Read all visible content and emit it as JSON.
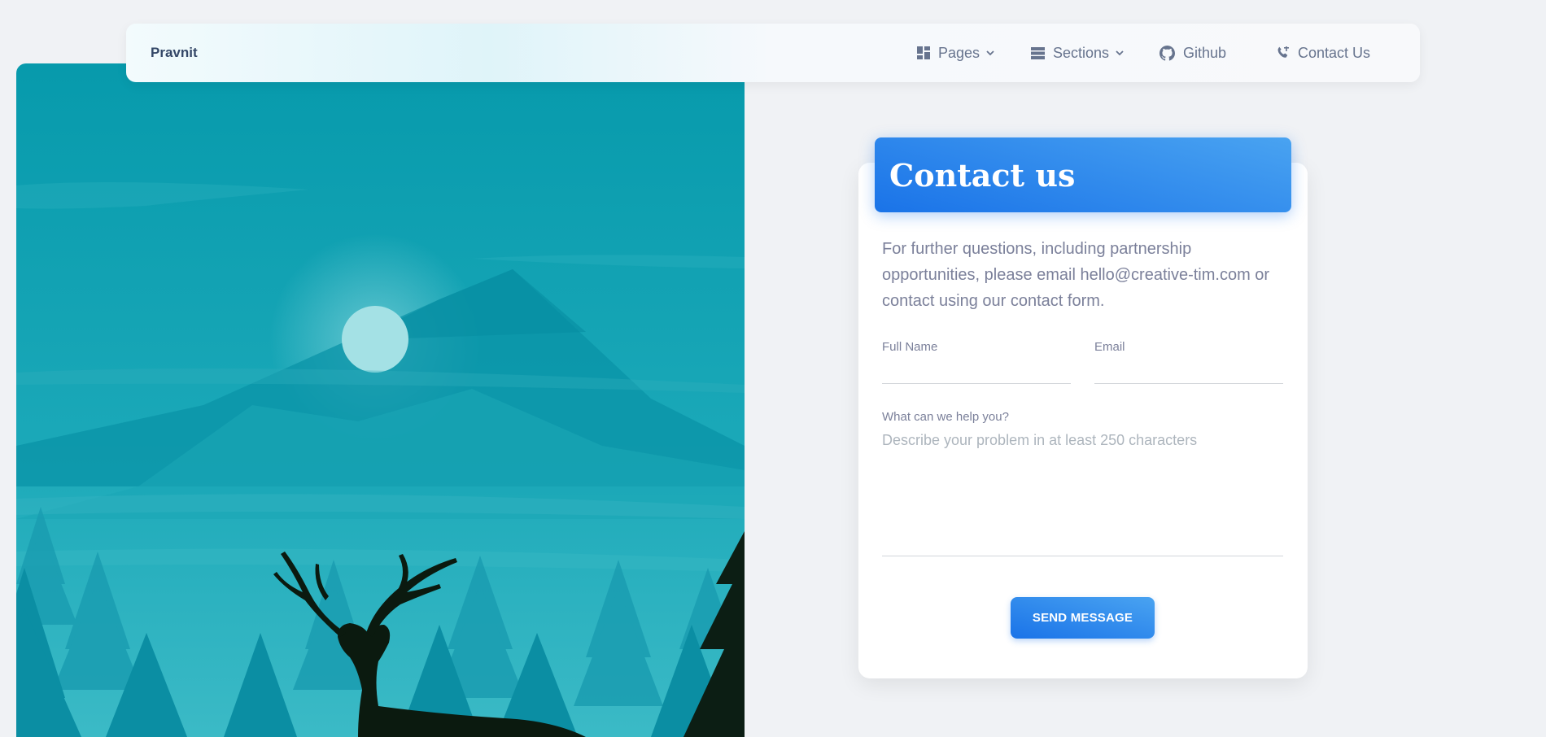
{
  "navbar": {
    "brand": "Pravnit",
    "items": [
      {
        "label": "Pages",
        "icon": "dashboard-icon",
        "dropdown": true
      },
      {
        "label": "Sections",
        "icon": "view-list-icon",
        "dropdown": true
      },
      {
        "label": "Github",
        "icon": "github-icon",
        "dropdown": false
      },
      {
        "label": "Contact Us",
        "icon": "phone-icon",
        "dropdown": false
      }
    ]
  },
  "contact": {
    "title": "Contact us",
    "intro": "For further questions, including partnership opportunities, please email hello@creative-tim.com or contact using our contact form.",
    "full_name_label": "Full Name",
    "email_label": "Email",
    "message_label": "What can we help you?",
    "message_placeholder": "Describe your problem in at least 250 characters",
    "submit_label": "SEND MESSAGE"
  },
  "colors": {
    "accent": "#1A73E8",
    "illustration_bg": "#079DAE",
    "text_muted": "#7b809a",
    "brand_text": "#344767"
  }
}
